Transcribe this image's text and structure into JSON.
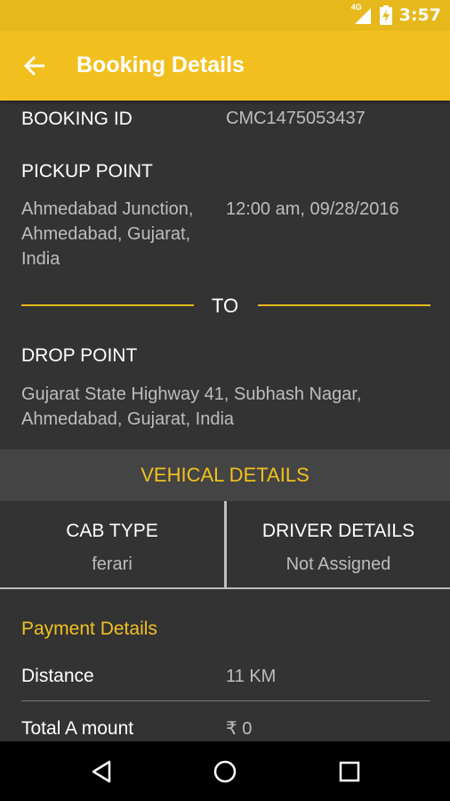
{
  "status_bar": {
    "network": "4G",
    "time": "3:57"
  },
  "app_bar": {
    "title": "Booking Details",
    "back_icon": "arrow-left-icon"
  },
  "booking": {
    "booking_id_label": "BOOKING ID",
    "booking_id_value": "CMC1475053437",
    "pickup_label": "PICKUP POINT",
    "pickup_address_lines": [
      "Ahmedabad Junction,",
      "Ahmedabad, Gujarat,",
      "India"
    ],
    "pickup_datetime": "12:00 am, 09/28/2016",
    "to_label": "TO",
    "drop_label": "DROP POINT",
    "drop_address_lines": [
      "Gujarat State Highway 41, Subhash Nagar,",
      "Ahmedabad, Gujarat, India"
    ]
  },
  "vehicle": {
    "header": "VEHICAL DETAILS",
    "cab_type_label": "CAB TYPE",
    "cab_type_value": "ferari",
    "driver_label": "DRIVER DETAILS",
    "driver_value": "Not Assigned"
  },
  "payment": {
    "title": "Payment Details",
    "distance_label": "Distance",
    "distance_value": "11 KM",
    "total_label": "Total A mount",
    "total_value": "₹ 0"
  },
  "nav_bar": {
    "back_icon": "triangle-back-icon",
    "home_icon": "circle-home-icon",
    "recents_icon": "square-recents-icon"
  },
  "colors": {
    "accent": "#f2c01e",
    "status_bar": "#e6b81c",
    "background": "#333333",
    "section_header": "#444444",
    "muted_text": "#bdbdbd"
  }
}
